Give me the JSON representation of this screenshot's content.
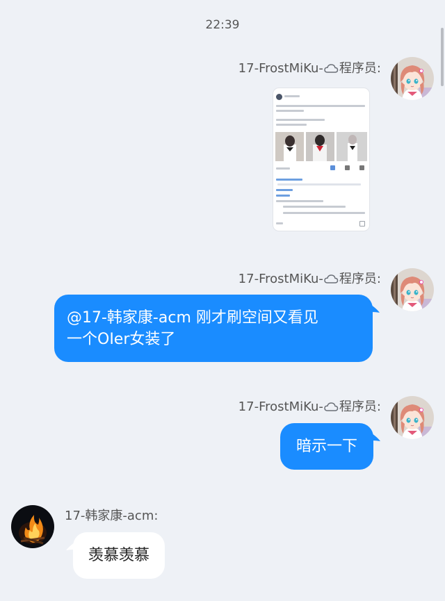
{
  "status": {
    "time": "22:39"
  },
  "messages": [
    {
      "sender_name": "17-FrostMiKu-",
      "sender_title": "程序员:",
      "type": "image"
    },
    {
      "sender_name": "17-FrostMiKu-",
      "sender_title": "程序员:",
      "type": "text",
      "lines": [
        "@17-韩家康-acm 刚才刷空间又看见",
        "一个OIer女装了"
      ]
    },
    {
      "sender_name": "17-FrostMiKu-",
      "sender_title": "程序员:",
      "type": "text",
      "lines": [
        "暗示一下"
      ]
    },
    {
      "sender_name": "17-韩家康-acm:",
      "sender_title": "",
      "type": "text",
      "lines": [
        "羡慕羡慕"
      ]
    }
  ],
  "icons": {
    "cloud": "cloud-icon",
    "avatar_girl": "anime-girl-avatar",
    "avatar_fire": "campfire-avatar"
  },
  "colors": {
    "background": "#eef1f6",
    "bubble_blue": "#1a8cff",
    "bubble_white": "#ffffff",
    "name_text": "#555555"
  }
}
